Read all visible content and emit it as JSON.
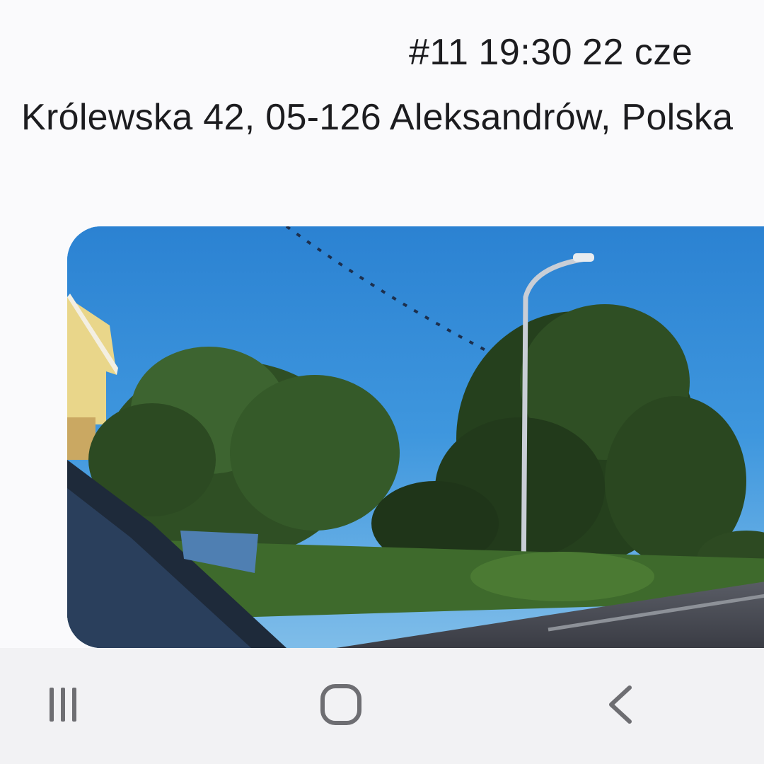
{
  "entry": {
    "number": "#11",
    "time": "19:30",
    "date": "22 cze",
    "address": "Królewska 42, 05-126 Aleksandrów, Polska"
  },
  "photo": {
    "description_icon": "street-photo"
  },
  "navbar": {
    "recents_icon": "recents-icon",
    "home_icon": "home-icon",
    "back_icon": "back-icon"
  }
}
